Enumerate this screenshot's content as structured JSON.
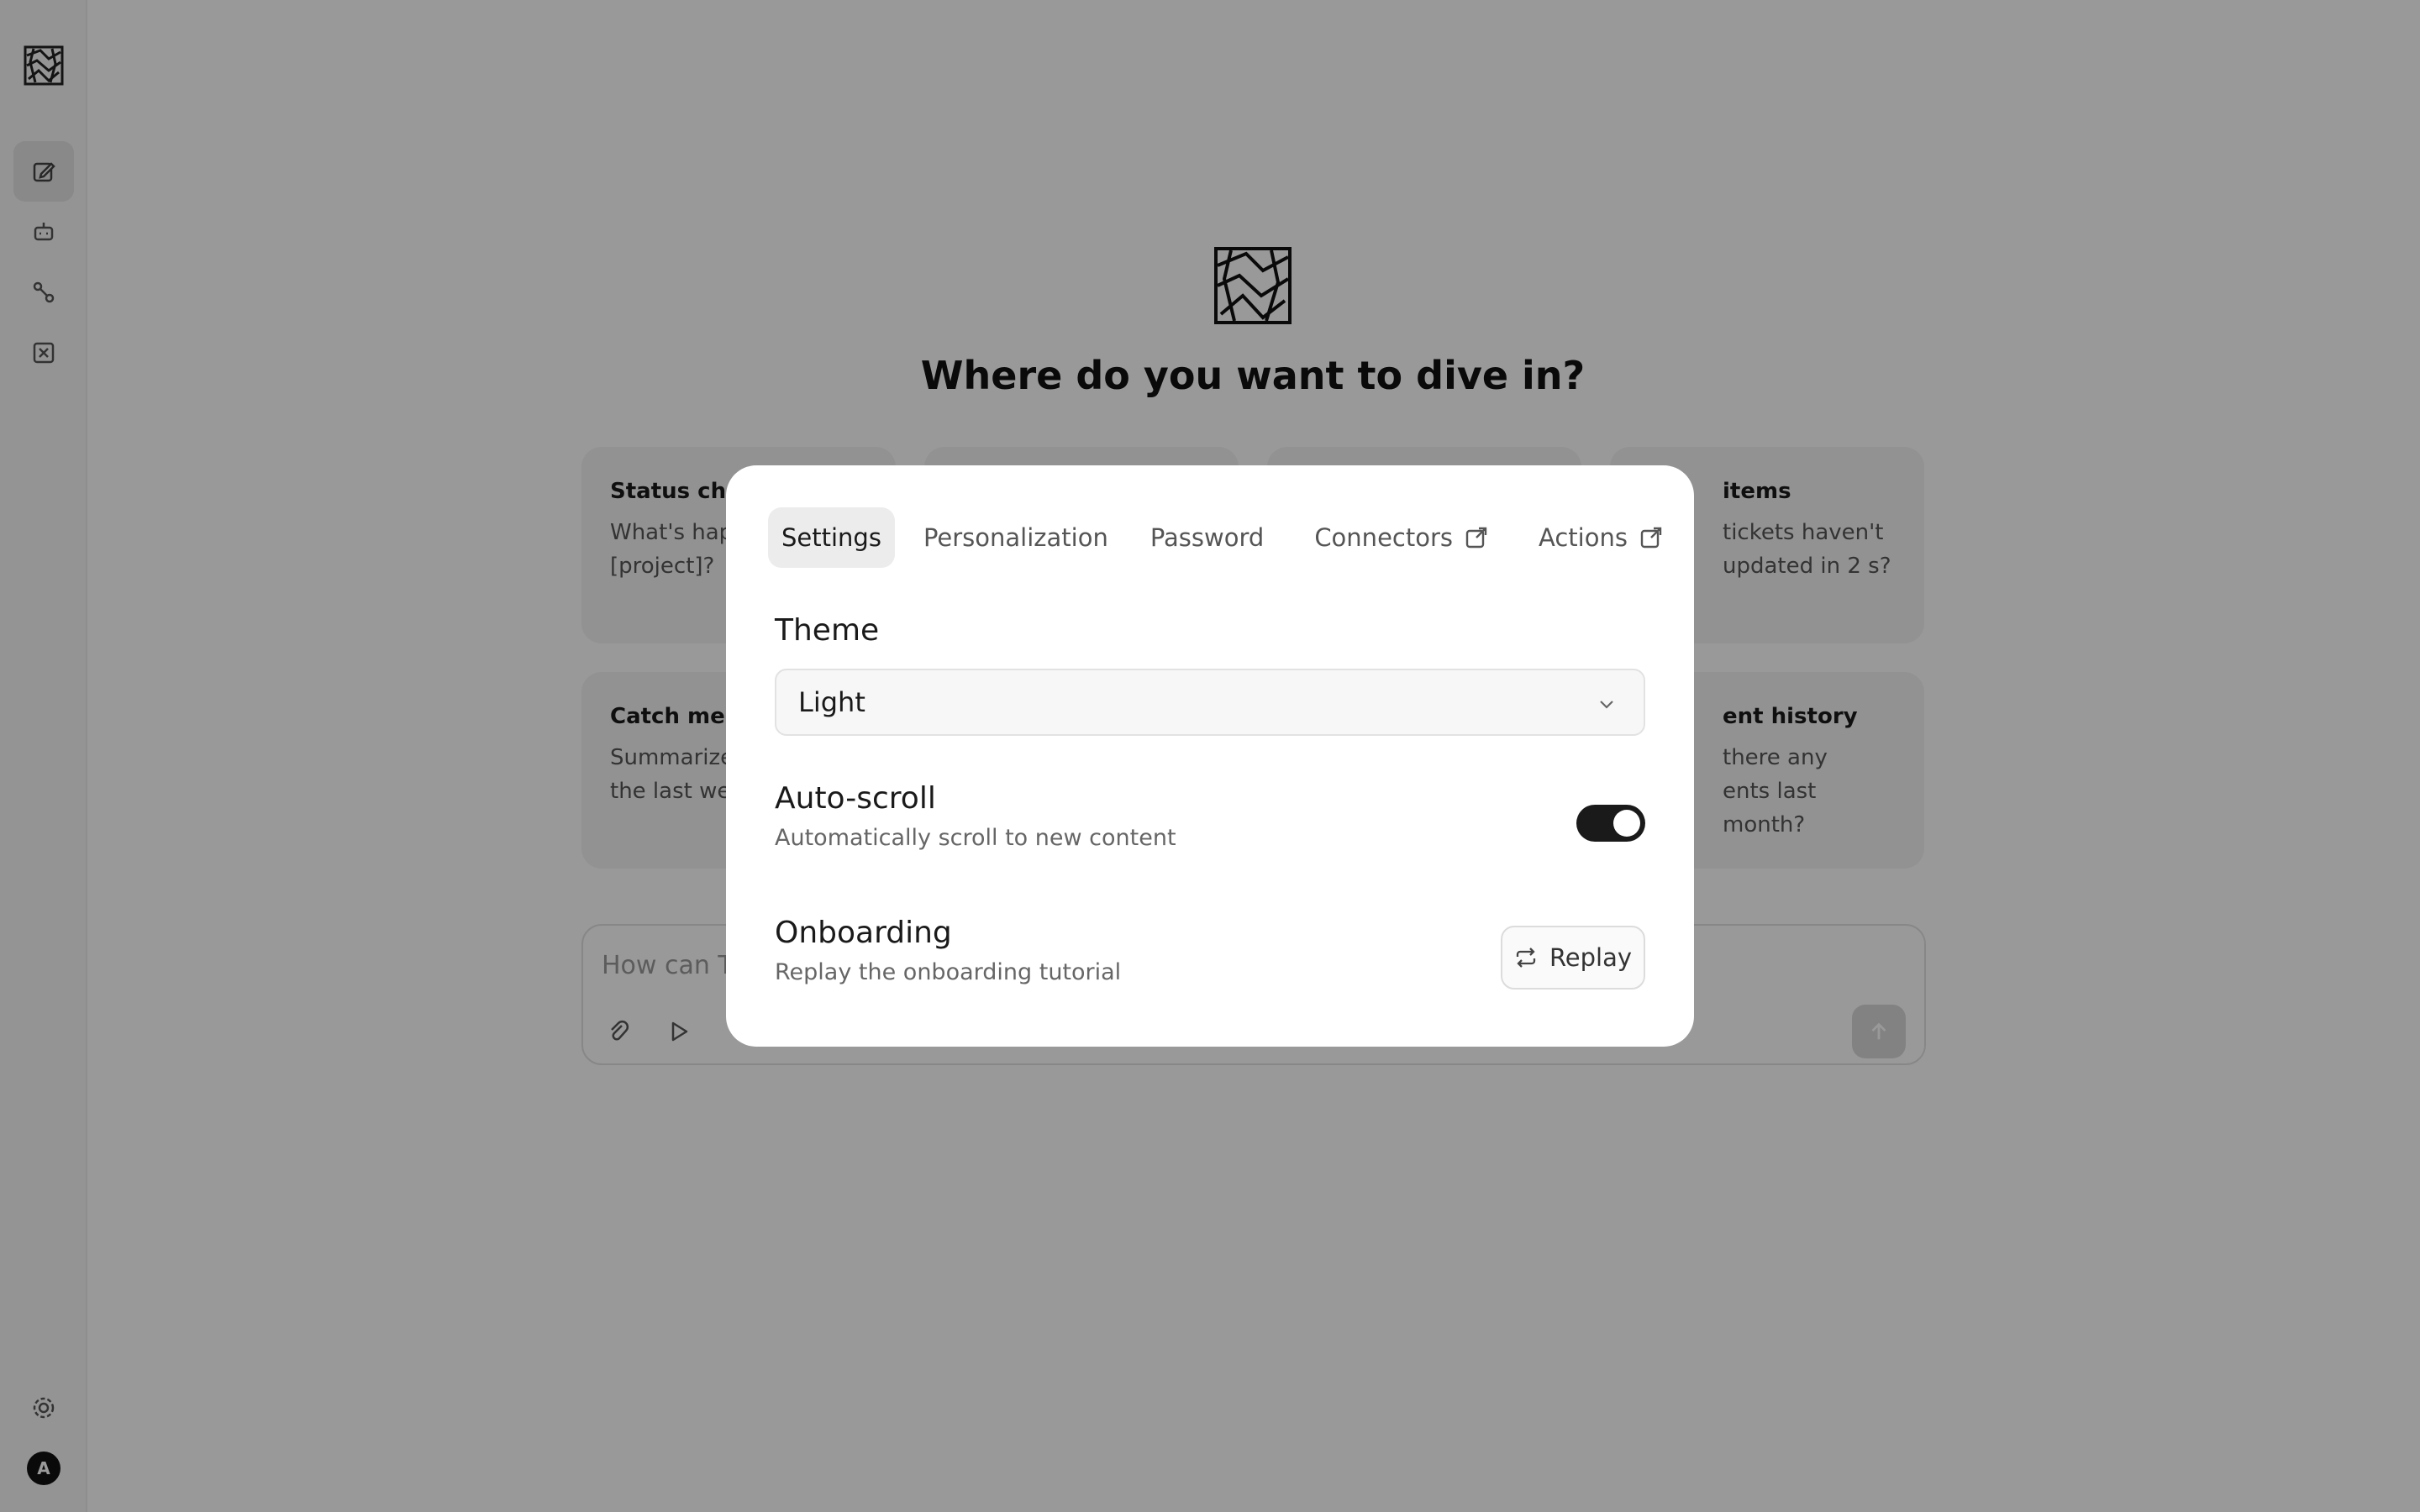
{
  "main": {
    "title": "Where do you want to dive in?",
    "composer_placeholder": "How can T",
    "cards": [
      {
        "title": "Status chec",
        "desc": "What's hap\n[project]?"
      },
      {
        "title": "",
        "desc": ""
      },
      {
        "title": "",
        "desc": ""
      },
      {
        "title": "items",
        "desc": "tickets haven't\nupdated in 2\ns?"
      },
      {
        "title": "Catch me u",
        "desc": "Summarize\nthe last we"
      },
      {
        "title": "ent history",
        "desc": "there any\nents last month?"
      }
    ]
  },
  "sidebar": {
    "avatar_letter": "A",
    "icons": [
      "new-chat-icon",
      "bot-icon",
      "workflow-icon",
      "close-box-icon",
      "gear-icon"
    ]
  },
  "modal": {
    "tabs": [
      {
        "label": "Settings",
        "external": false
      },
      {
        "label": "Personalization",
        "external": false
      },
      {
        "label": "Password",
        "external": false
      },
      {
        "label": "Connectors",
        "external": true
      },
      {
        "label": "Actions",
        "external": true
      }
    ],
    "theme": {
      "label": "Theme",
      "value": "Light"
    },
    "autoscroll": {
      "label": "Auto-scroll",
      "desc": "Automatically scroll to new content",
      "enabled": true
    },
    "onboarding": {
      "label": "Onboarding",
      "desc": "Replay the onboarding tutorial",
      "button": "Replay"
    }
  }
}
